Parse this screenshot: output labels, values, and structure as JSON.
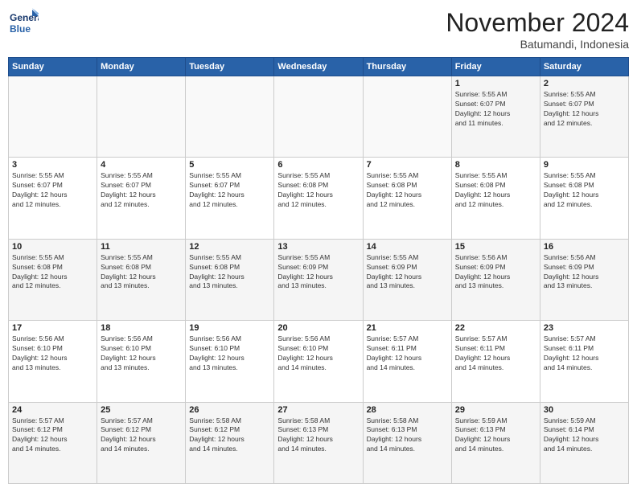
{
  "logo": {
    "line1": "General",
    "line2": "Blue"
  },
  "header": {
    "month_year": "November 2024",
    "location": "Batumandi, Indonesia"
  },
  "weekdays": [
    "Sunday",
    "Monday",
    "Tuesday",
    "Wednesday",
    "Thursday",
    "Friday",
    "Saturday"
  ],
  "weeks": [
    [
      {
        "day": "",
        "info": ""
      },
      {
        "day": "",
        "info": ""
      },
      {
        "day": "",
        "info": ""
      },
      {
        "day": "",
        "info": ""
      },
      {
        "day": "",
        "info": ""
      },
      {
        "day": "1",
        "info": "Sunrise: 5:55 AM\nSunset: 6:07 PM\nDaylight: 12 hours\nand 11 minutes."
      },
      {
        "day": "2",
        "info": "Sunrise: 5:55 AM\nSunset: 6:07 PM\nDaylight: 12 hours\nand 12 minutes."
      }
    ],
    [
      {
        "day": "3",
        "info": "Sunrise: 5:55 AM\nSunset: 6:07 PM\nDaylight: 12 hours\nand 12 minutes."
      },
      {
        "day": "4",
        "info": "Sunrise: 5:55 AM\nSunset: 6:07 PM\nDaylight: 12 hours\nand 12 minutes."
      },
      {
        "day": "5",
        "info": "Sunrise: 5:55 AM\nSunset: 6:07 PM\nDaylight: 12 hours\nand 12 minutes."
      },
      {
        "day": "6",
        "info": "Sunrise: 5:55 AM\nSunset: 6:08 PM\nDaylight: 12 hours\nand 12 minutes."
      },
      {
        "day": "7",
        "info": "Sunrise: 5:55 AM\nSunset: 6:08 PM\nDaylight: 12 hours\nand 12 minutes."
      },
      {
        "day": "8",
        "info": "Sunrise: 5:55 AM\nSunset: 6:08 PM\nDaylight: 12 hours\nand 12 minutes."
      },
      {
        "day": "9",
        "info": "Sunrise: 5:55 AM\nSunset: 6:08 PM\nDaylight: 12 hours\nand 12 minutes."
      }
    ],
    [
      {
        "day": "10",
        "info": "Sunrise: 5:55 AM\nSunset: 6:08 PM\nDaylight: 12 hours\nand 12 minutes."
      },
      {
        "day": "11",
        "info": "Sunrise: 5:55 AM\nSunset: 6:08 PM\nDaylight: 12 hours\nand 13 minutes."
      },
      {
        "day": "12",
        "info": "Sunrise: 5:55 AM\nSunset: 6:08 PM\nDaylight: 12 hours\nand 13 minutes."
      },
      {
        "day": "13",
        "info": "Sunrise: 5:55 AM\nSunset: 6:09 PM\nDaylight: 12 hours\nand 13 minutes."
      },
      {
        "day": "14",
        "info": "Sunrise: 5:55 AM\nSunset: 6:09 PM\nDaylight: 12 hours\nand 13 minutes."
      },
      {
        "day": "15",
        "info": "Sunrise: 5:56 AM\nSunset: 6:09 PM\nDaylight: 12 hours\nand 13 minutes."
      },
      {
        "day": "16",
        "info": "Sunrise: 5:56 AM\nSunset: 6:09 PM\nDaylight: 12 hours\nand 13 minutes."
      }
    ],
    [
      {
        "day": "17",
        "info": "Sunrise: 5:56 AM\nSunset: 6:10 PM\nDaylight: 12 hours\nand 13 minutes."
      },
      {
        "day": "18",
        "info": "Sunrise: 5:56 AM\nSunset: 6:10 PM\nDaylight: 12 hours\nand 13 minutes."
      },
      {
        "day": "19",
        "info": "Sunrise: 5:56 AM\nSunset: 6:10 PM\nDaylight: 12 hours\nand 13 minutes."
      },
      {
        "day": "20",
        "info": "Sunrise: 5:56 AM\nSunset: 6:10 PM\nDaylight: 12 hours\nand 14 minutes."
      },
      {
        "day": "21",
        "info": "Sunrise: 5:57 AM\nSunset: 6:11 PM\nDaylight: 12 hours\nand 14 minutes."
      },
      {
        "day": "22",
        "info": "Sunrise: 5:57 AM\nSunset: 6:11 PM\nDaylight: 12 hours\nand 14 minutes."
      },
      {
        "day": "23",
        "info": "Sunrise: 5:57 AM\nSunset: 6:11 PM\nDaylight: 12 hours\nand 14 minutes."
      }
    ],
    [
      {
        "day": "24",
        "info": "Sunrise: 5:57 AM\nSunset: 6:12 PM\nDaylight: 12 hours\nand 14 minutes."
      },
      {
        "day": "25",
        "info": "Sunrise: 5:57 AM\nSunset: 6:12 PM\nDaylight: 12 hours\nand 14 minutes."
      },
      {
        "day": "26",
        "info": "Sunrise: 5:58 AM\nSunset: 6:12 PM\nDaylight: 12 hours\nand 14 minutes."
      },
      {
        "day": "27",
        "info": "Sunrise: 5:58 AM\nSunset: 6:13 PM\nDaylight: 12 hours\nand 14 minutes."
      },
      {
        "day": "28",
        "info": "Sunrise: 5:58 AM\nSunset: 6:13 PM\nDaylight: 12 hours\nand 14 minutes."
      },
      {
        "day": "29",
        "info": "Sunrise: 5:59 AM\nSunset: 6:13 PM\nDaylight: 12 hours\nand 14 minutes."
      },
      {
        "day": "30",
        "info": "Sunrise: 5:59 AM\nSunset: 6:14 PM\nDaylight: 12 hours\nand 14 minutes."
      }
    ]
  ]
}
